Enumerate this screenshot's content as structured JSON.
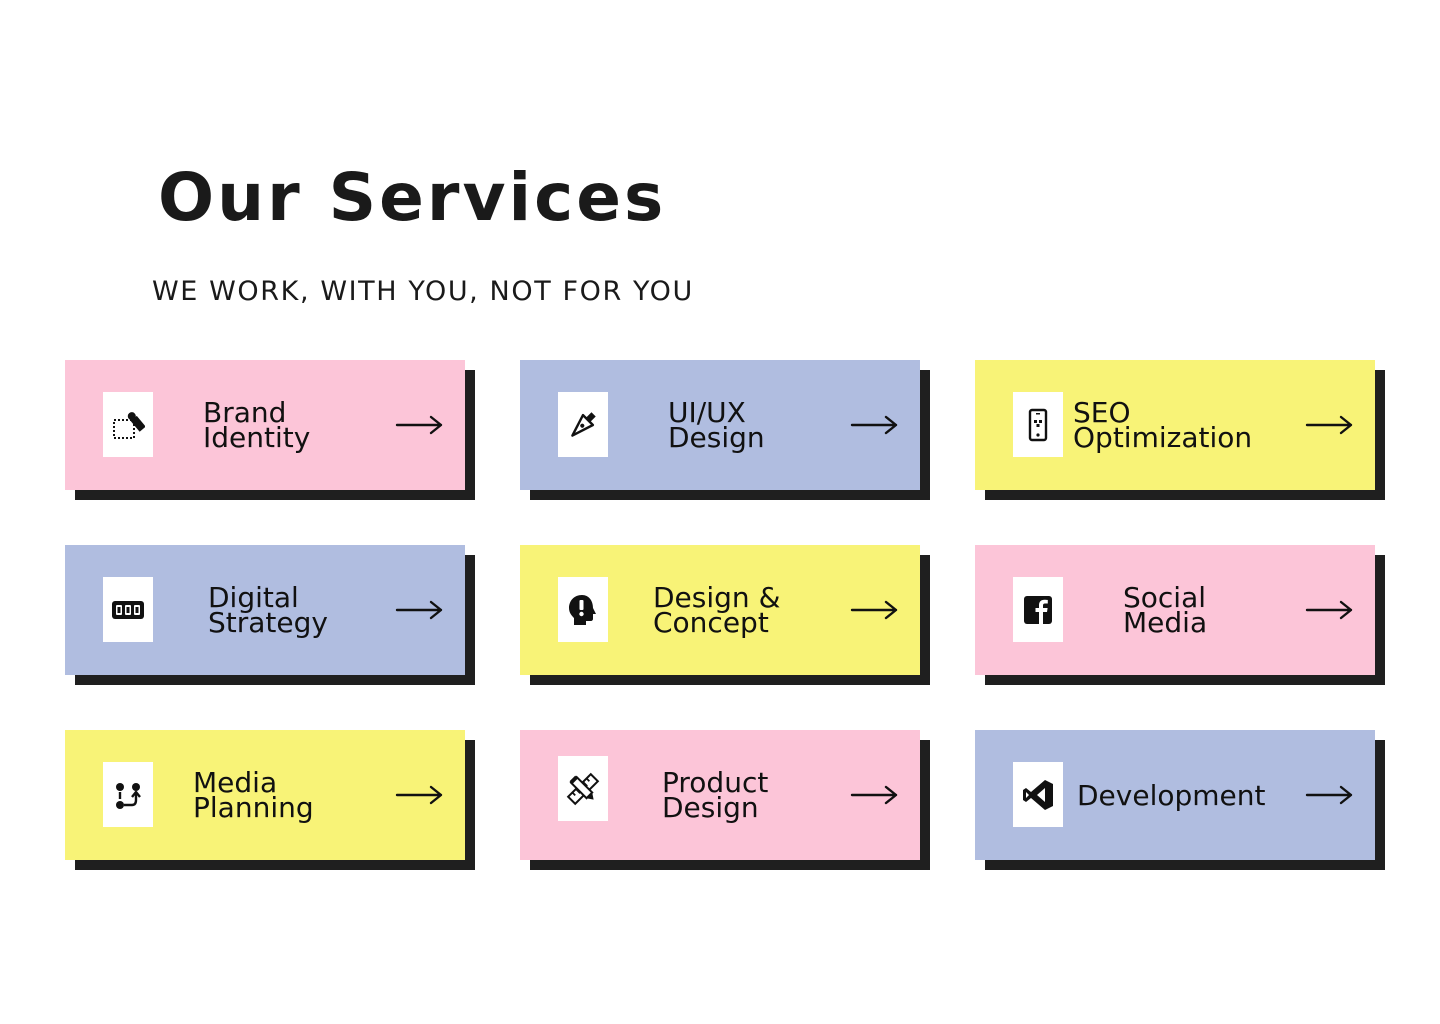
{
  "header": {
    "title": "Our Services",
    "subtitle": "WE WORK, WITH YOU, NOT FOR YOU"
  },
  "colors": {
    "pink": "#fcc5d8",
    "blue": "#b0bde0",
    "yellow": "#f8f377",
    "shadow": "#1f1f1f"
  },
  "services": [
    {
      "line1": "Brand",
      "line2": "Identity",
      "icon": "brand-stamp-icon",
      "color": "#fcc5d8"
    },
    {
      "line1": "UI/UX",
      "line2": "Design",
      "icon": "pen-nib-icon",
      "color": "#b0bde0"
    },
    {
      "line1": "SEO",
      "line2": "Optimization",
      "icon": "smartphone-icon",
      "color": "#f8f377"
    },
    {
      "line1": "Digital",
      "line2": "Strategy",
      "icon": "film-strip-icon",
      "color": "#b0bde0"
    },
    {
      "line1": "Design &",
      "line2": "Concept",
      "icon": "head-idea-icon",
      "color": "#f8f377"
    },
    {
      "line1": "Social",
      "line2": "Media",
      "icon": "facebook-icon",
      "color": "#fcc5d8"
    },
    {
      "line1": "Media",
      "line2": "Planning",
      "icon": "flow-chart-icon",
      "color": "#f8f377"
    },
    {
      "line1": "Product",
      "line2": "Design",
      "icon": "pencil-ruler-icon",
      "color": "#fcc5d8"
    },
    {
      "line1": "Development",
      "line2": "",
      "icon": "code-editor-icon",
      "color": "#b0bde0"
    }
  ]
}
